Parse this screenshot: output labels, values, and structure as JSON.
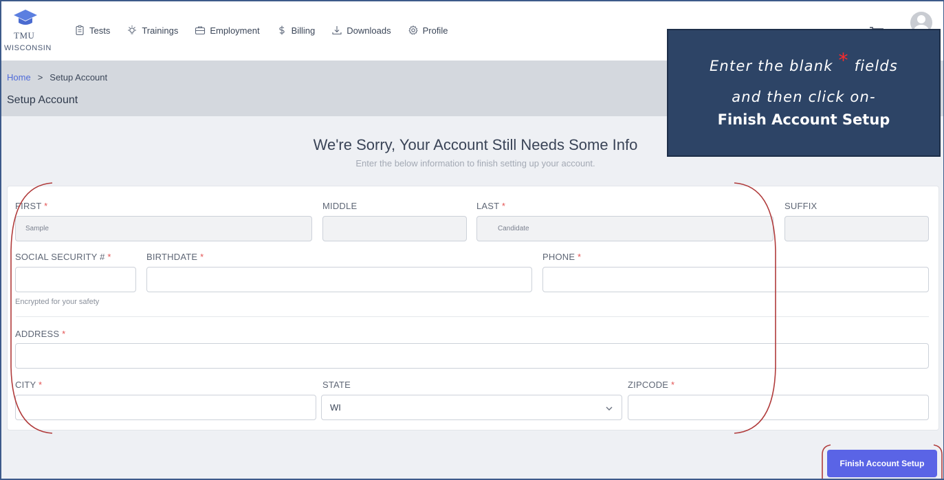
{
  "brand": {
    "name": "TMU",
    "sub": "WISCONSIN"
  },
  "nav": [
    {
      "label": "Tests",
      "icon": "clipboard-icon"
    },
    {
      "label": "Trainings",
      "icon": "lightbulb-icon"
    },
    {
      "label": "Employment",
      "icon": "briefcase-icon"
    },
    {
      "label": "Billing",
      "icon": "dollar-icon"
    },
    {
      "label": "Downloads",
      "icon": "download-icon"
    },
    {
      "label": "Profile",
      "icon": "gear-icon"
    }
  ],
  "breadcrumb": {
    "home": "Home",
    "separator": ">",
    "current": "Setup Account"
  },
  "page_title": "Setup Account",
  "headline": "We're Sorry, Your Account Still Needs Some Info",
  "subline": "Enter the below information to finish setting up your account.",
  "form": {
    "required_mark": "*",
    "first": {
      "label": "FIRST",
      "value": "Sample"
    },
    "middle": {
      "label": "MIDDLE",
      "value": ""
    },
    "last": {
      "label": "LAST",
      "value": "Candidate"
    },
    "suffix": {
      "label": "SUFFIX",
      "value": ""
    },
    "ssn": {
      "label": "SOCIAL SECURITY #",
      "value": "",
      "hint": "Encrypted for your safety"
    },
    "birthdate": {
      "label": "BIRTHDATE",
      "value": ""
    },
    "phone": {
      "label": "PHONE",
      "value": ""
    },
    "address": {
      "label": "ADDRESS",
      "value": ""
    },
    "city": {
      "label": "CITY",
      "value": ""
    },
    "state": {
      "label": "STATE",
      "value": "WI"
    },
    "zipcode": {
      "label": "ZIPCODE",
      "value": ""
    }
  },
  "callout": {
    "line1_before": "Enter the blank",
    "star": "*",
    "line1_after": "fields",
    "line2": "and then click on-",
    "line3": "Finish Account Setup"
  },
  "finish_button": "Finish Account Setup",
  "colors": {
    "accent": "#5a64e6",
    "callout_bg": "#2d4466",
    "required": "#e45454",
    "annotation": "#b03a3a"
  }
}
